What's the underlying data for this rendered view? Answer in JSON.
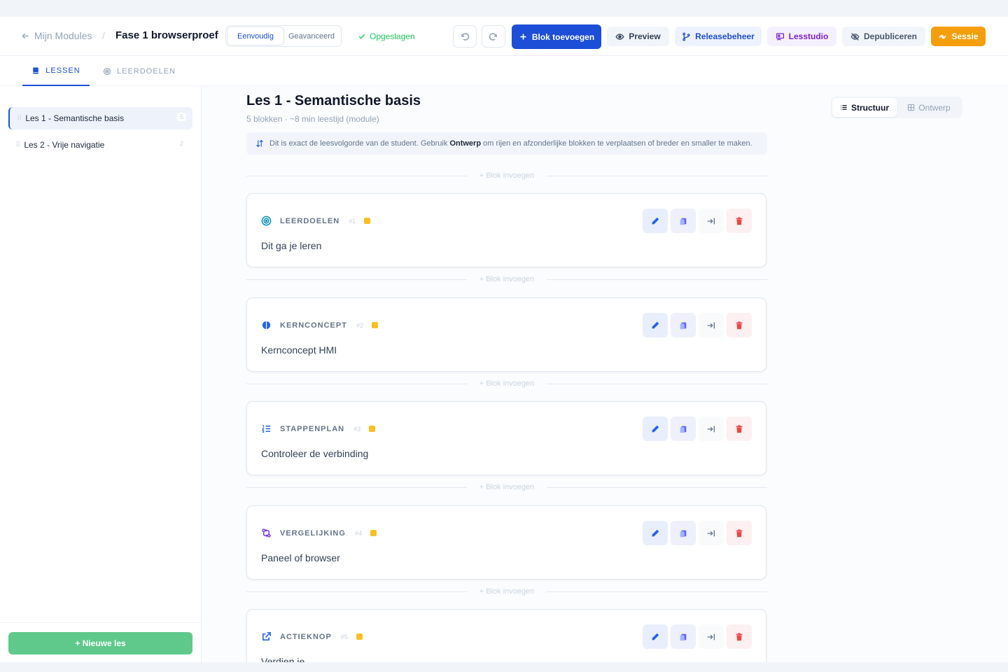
{
  "header": {
    "back_label": "Mijn Modules",
    "separator": "/",
    "module_title": "Fase 1 browserproef",
    "modes": [
      "Eenvoudig",
      "Geavanceerd"
    ],
    "saved_label": "Opgeslagen",
    "add_block_label": "Blok toevoegen",
    "preview_label": "Preview",
    "release_label": "Releasebeheer",
    "studio_label": "Lesstudio",
    "depublish_label": "Depubliceren",
    "session_label": "Sessie"
  },
  "tabs": [
    {
      "label": "LESSEN",
      "active": true
    },
    {
      "label": "LEERDOELEN",
      "active": false
    }
  ],
  "sidebar": {
    "lessons": [
      {
        "title": "Les 1 - Semantische basis",
        "count": "5",
        "active": true
      },
      {
        "title": "Les 2 - Vrije navigatie",
        "count": "2",
        "active": false
      }
    ],
    "new_lesson_label": "+ Nieuwe les"
  },
  "main": {
    "title": "Les 1 - Semantische basis",
    "meta": "5 blokken · ~8 min leestijd (module)",
    "info": {
      "pre": "Dit is exact de leesvolgorde van de student. Gebruik",
      "bold": "Ontwerp",
      "post": "om rijen en afzonderlijke blokken te verplaatsen of breder en smaller te maken."
    },
    "view_toggle": [
      "Structuur",
      "Ontwerp"
    ],
    "insert_label": "Blok invoegen",
    "blocks": [
      {
        "type": "LEERDOELEN",
        "num": "#1",
        "text": "Dit ga je leren",
        "icon": "target-icon",
        "color": "#0891b2"
      },
      {
        "type": "KERNCONCEPT",
        "num": "#2",
        "text": "Kernconcept HMI",
        "icon": "brain-icon",
        "color": "#2563eb"
      },
      {
        "type": "STAPPENPLAN",
        "num": "#3",
        "text": "Controleer de verbinding",
        "icon": "list-ordered-icon",
        "color": "#2563eb"
      },
      {
        "type": "VERGELIJKING",
        "num": "#4",
        "text": "Paneel of browser",
        "icon": "compare-icon",
        "color": "#7c3aed"
      },
      {
        "type": "ACTIEKNOP",
        "num": "#5",
        "text": "Verdien je",
        "icon": "external-link-icon",
        "color": "#2563eb"
      }
    ]
  },
  "colors": {
    "primary": "#1d4ed8",
    "session": "#f59e0b",
    "new_lesson": "#5ec98b",
    "saved": "#22c55e",
    "delete": "#ef4444"
  }
}
